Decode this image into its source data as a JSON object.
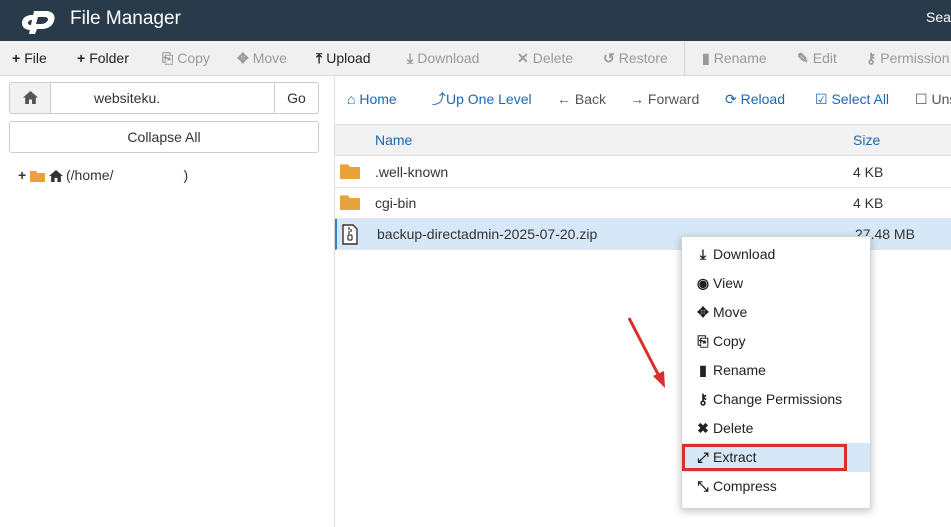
{
  "header": {
    "title": "File Manager",
    "search_label": "Sea"
  },
  "toolbar": {
    "file": "File",
    "folder": "Folder",
    "copy": "Copy",
    "move": "Move",
    "upload": "Upload",
    "download": "Download",
    "delete": "Delete",
    "restore": "Restore",
    "rename": "Rename",
    "edit": "Edit",
    "permissions": "Permission"
  },
  "sidebar": {
    "path_value": "websiteku.",
    "go": "Go",
    "collapse_all": "Collapse All",
    "tree_root_label": "(/home/",
    "tree_root_close": ")"
  },
  "nav": {
    "home": "Home",
    "up": "Up One Level",
    "back": "Back",
    "forward": "Forward",
    "reload": "Reload",
    "select_all": "Select All",
    "unselect": "Uns"
  },
  "table": {
    "columns": {
      "name": "Name",
      "size": "Size"
    },
    "rows": [
      {
        "name": ".well-known",
        "size": "4 KB",
        "type": "folder"
      },
      {
        "name": "cgi-bin",
        "size": "4 KB",
        "type": "folder"
      },
      {
        "name": "backup-directadmin-2025-07-20.zip",
        "size": "27.48 MB",
        "type": "zip"
      }
    ]
  },
  "context_menu": {
    "items": [
      {
        "label": "Download",
        "icon": "download-icon"
      },
      {
        "label": "View",
        "icon": "eye-icon"
      },
      {
        "label": "Move",
        "icon": "move-icon"
      },
      {
        "label": "Copy",
        "icon": "copy-icon"
      },
      {
        "label": "Rename",
        "icon": "file-icon"
      },
      {
        "label": "Change Permissions",
        "icon": "key-icon"
      },
      {
        "label": "Delete",
        "icon": "close-icon"
      },
      {
        "label": "Extract",
        "icon": "expand-icon"
      },
      {
        "label": "Compress",
        "icon": "compress-icon"
      }
    ],
    "highlighted": "Extract"
  },
  "colors": {
    "topbar": "#293a4a",
    "link": "#1a67b3",
    "selection": "#d6e8f7",
    "annotation": "#d9302d"
  }
}
